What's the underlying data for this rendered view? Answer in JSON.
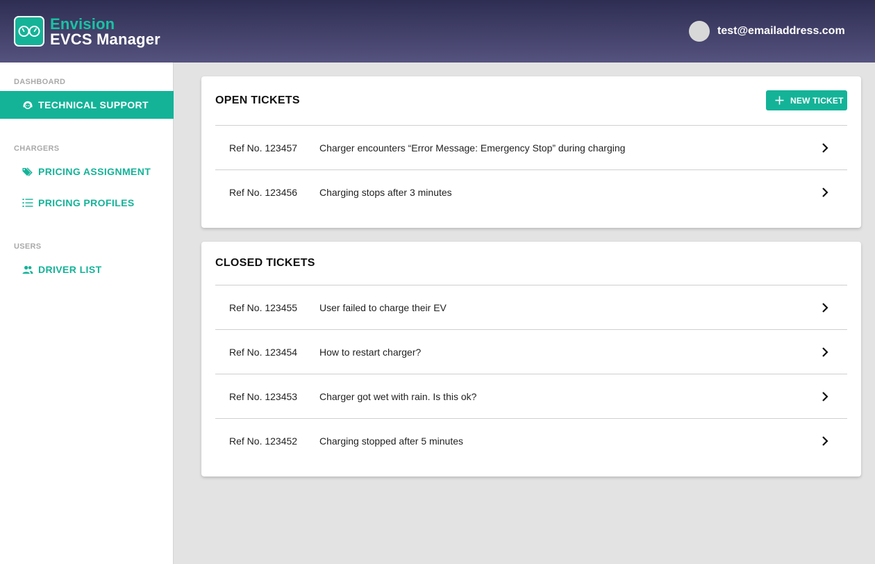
{
  "app": {
    "brand_line1": "Envision",
    "brand_line2": "EVCS Manager",
    "user_email": "test@emailaddress.com"
  },
  "colors": {
    "accent": "#14b398",
    "header_top": "#2e2d52",
    "header_bottom": "#55537f"
  },
  "sidebar": {
    "sections": [
      {
        "label": "DASHBOARD",
        "items": [
          {
            "label": "TECHNICAL SUPPORT",
            "icon": "support-agent-icon",
            "active": true
          }
        ]
      },
      {
        "label": "CHARGERS",
        "items": [
          {
            "label": "PRICING ASSIGNMENT",
            "icon": "tags-icon"
          },
          {
            "label": "PRICING PROFILES",
            "icon": "list-icon"
          }
        ]
      },
      {
        "label": "USERS",
        "items": [
          {
            "label": "DRIVER LIST",
            "icon": "people-icon"
          }
        ]
      }
    ]
  },
  "open_tickets": {
    "title": "OPEN TICKETS",
    "new_ticket_label": "NEW TICKET",
    "rows": [
      {
        "ref": "Ref No. 123457",
        "desc": "Charger encounters “Error Message: Emergency Stop” during charging"
      },
      {
        "ref": "Ref No. 123456",
        "desc": "Charging stops after 3 minutes"
      }
    ]
  },
  "closed_tickets": {
    "title": "CLOSED TICKETS",
    "rows": [
      {
        "ref": "Ref No. 123455",
        "desc": "User failed to charge their EV"
      },
      {
        "ref": "Ref No. 123454",
        "desc": "How to restart charger?"
      },
      {
        "ref": "Ref No. 123453",
        "desc": "Charger got wet with rain. Is this ok?"
      },
      {
        "ref": "Ref No. 123452",
        "desc": "Charging stopped after 5 minutes"
      }
    ]
  }
}
